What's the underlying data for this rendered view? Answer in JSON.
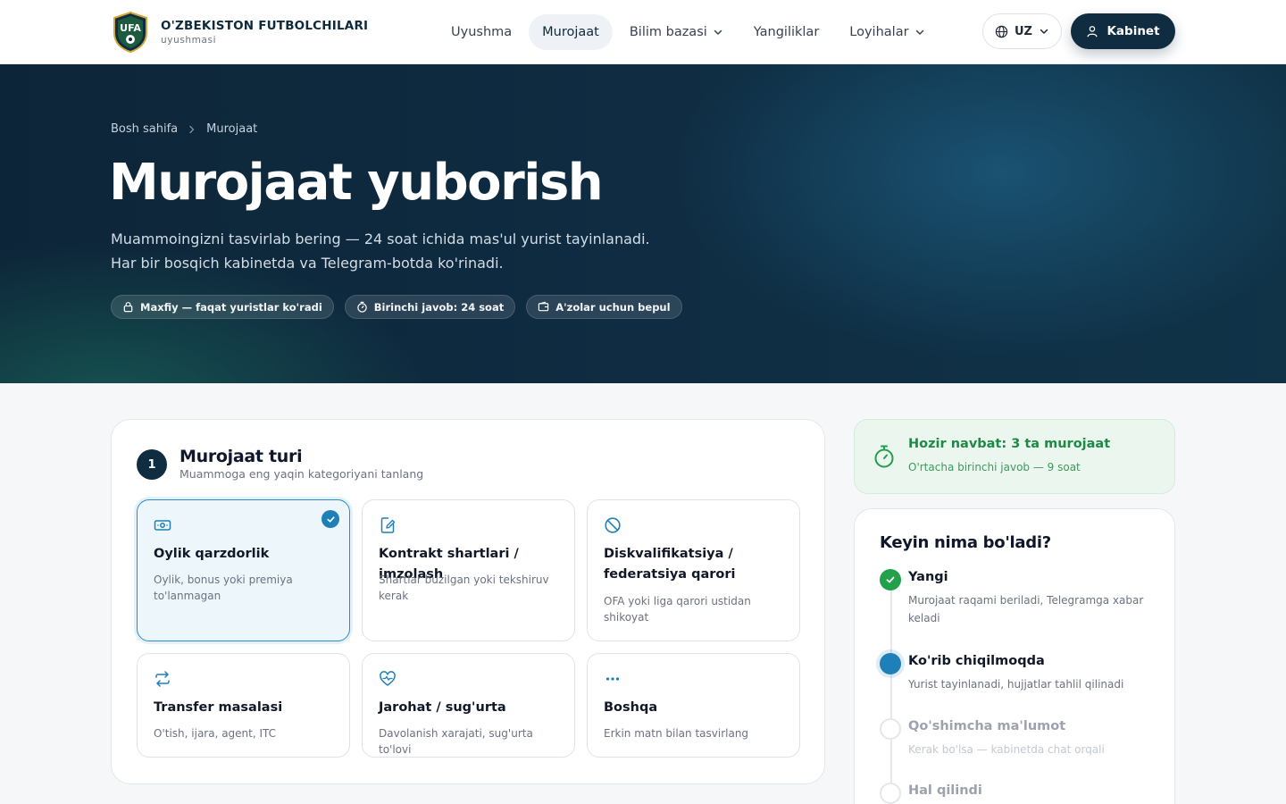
{
  "header": {
    "brand_title": "O'ZBEKISTON FUTBOLCHILARI",
    "brand_sub": "uyushmasi",
    "logo_text": "UFA",
    "nav": [
      {
        "label": "Uyushma",
        "active": false,
        "dropdown": false
      },
      {
        "label": "Murojaat",
        "active": true,
        "dropdown": false
      },
      {
        "label": "Bilim bazasi",
        "active": false,
        "dropdown": true
      },
      {
        "label": "Yangiliklar",
        "active": false,
        "dropdown": false
      },
      {
        "label": "Loyihalar",
        "active": false,
        "dropdown": true
      }
    ],
    "lang": "UZ",
    "cabinet": "Kabinet"
  },
  "hero": {
    "breadcrumb": [
      "Bosh sahifa",
      "Murojaat"
    ],
    "title": "Murojaat yuborish",
    "lead_line1": "Muammoingizni tasvirlab bering — 24 soat ichida mas'ul yurist tayinlanadi.",
    "lead_line2": "Har bir bosqich kabinetda va Telegram-botda ko'rinadi.",
    "pills": [
      {
        "label": "Maxfiy — faqat yuristlar ko'radi",
        "icon": "lock-icon"
      },
      {
        "label": "Birinchi javob: 24 soat",
        "icon": "timer-icon"
      },
      {
        "label": "A'zolar uchun bepul",
        "icon": "wallet-icon"
      }
    ]
  },
  "form": {
    "step_number": "1",
    "step_title": "Murojaat turi",
    "step_sub": "Muammoga eng yaqin kategoriyani tanlang",
    "tiles": [
      {
        "title": "Oylik qarzdorlik",
        "desc": "Oylik, bonus yoki premiya to'lanmagan",
        "icon": "cash-icon",
        "selected": true
      },
      {
        "title": "Kontrakt shartlari / imzolash",
        "desc": "Shartlar buzilgan yoki tekshiruv kerak",
        "icon": "contract-edit-icon",
        "selected": false
      },
      {
        "title": "Diskvalifikatsiya / federatsiya qarori",
        "desc": "OFA yoki liga qarori ustidan shikoyat",
        "icon": "ban-icon",
        "selected": false
      },
      {
        "title": "Transfer masalasi",
        "desc": "O'tish, ijara, agent, ITC",
        "icon": "transfer-icon",
        "selected": false
      },
      {
        "title": "Jarohat / sug'urta",
        "desc": "Davolanish xarajati, sug'urta to'lovi",
        "icon": "heart-pulse-icon",
        "selected": false
      },
      {
        "title": "Boshqa",
        "desc": "Erkin matn bilan tasvirlang",
        "icon": "more-icon",
        "selected": false
      }
    ]
  },
  "queue": {
    "title": "Hozir navbat: 3 ta murojaat",
    "sub": "O'rtacha birinchi javob — 9 soat"
  },
  "next": {
    "title": "Keyin nima bo'ladi?",
    "steps": [
      {
        "title": "Yangi",
        "desc": "Murojaat raqami beriladi, Telegramga xabar keladi",
        "status": "done"
      },
      {
        "title": "Ko'rib chiqilmoqda",
        "desc": "Yurist tayinlanadi, hujjatlar tahlil qilinadi",
        "status": "current"
      },
      {
        "title": "Qo'shimcha ma'lumot",
        "desc": "Kerak bo'lsa — kabinetda chat orqali",
        "status": "pending"
      },
      {
        "title": "Hal qilindi",
        "desc": "",
        "status": "pending"
      }
    ]
  },
  "colors": {
    "primary": "#0f2c40",
    "accent": "#1f7fb8",
    "success": "#22a04b"
  }
}
